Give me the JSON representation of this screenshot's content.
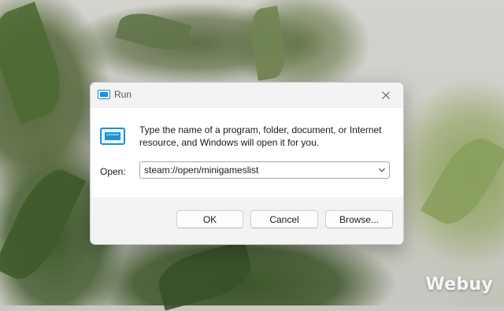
{
  "window": {
    "title": "Run",
    "close_icon": "close-icon",
    "app_icon": "run-icon"
  },
  "content": {
    "description": "Type the name of a program, folder, document, or Internet resource, and Windows will open it for you.",
    "open_label": "Open:",
    "open_value": "steam://open/minigameslist"
  },
  "buttons": {
    "ok": "OK",
    "cancel": "Cancel",
    "browse": "Browse..."
  },
  "watermark": "Webuy",
  "colors": {
    "icon_accent": "#1f8fd6",
    "dialog_bg": "#f3f3f3",
    "content_bg": "#ffffff"
  }
}
